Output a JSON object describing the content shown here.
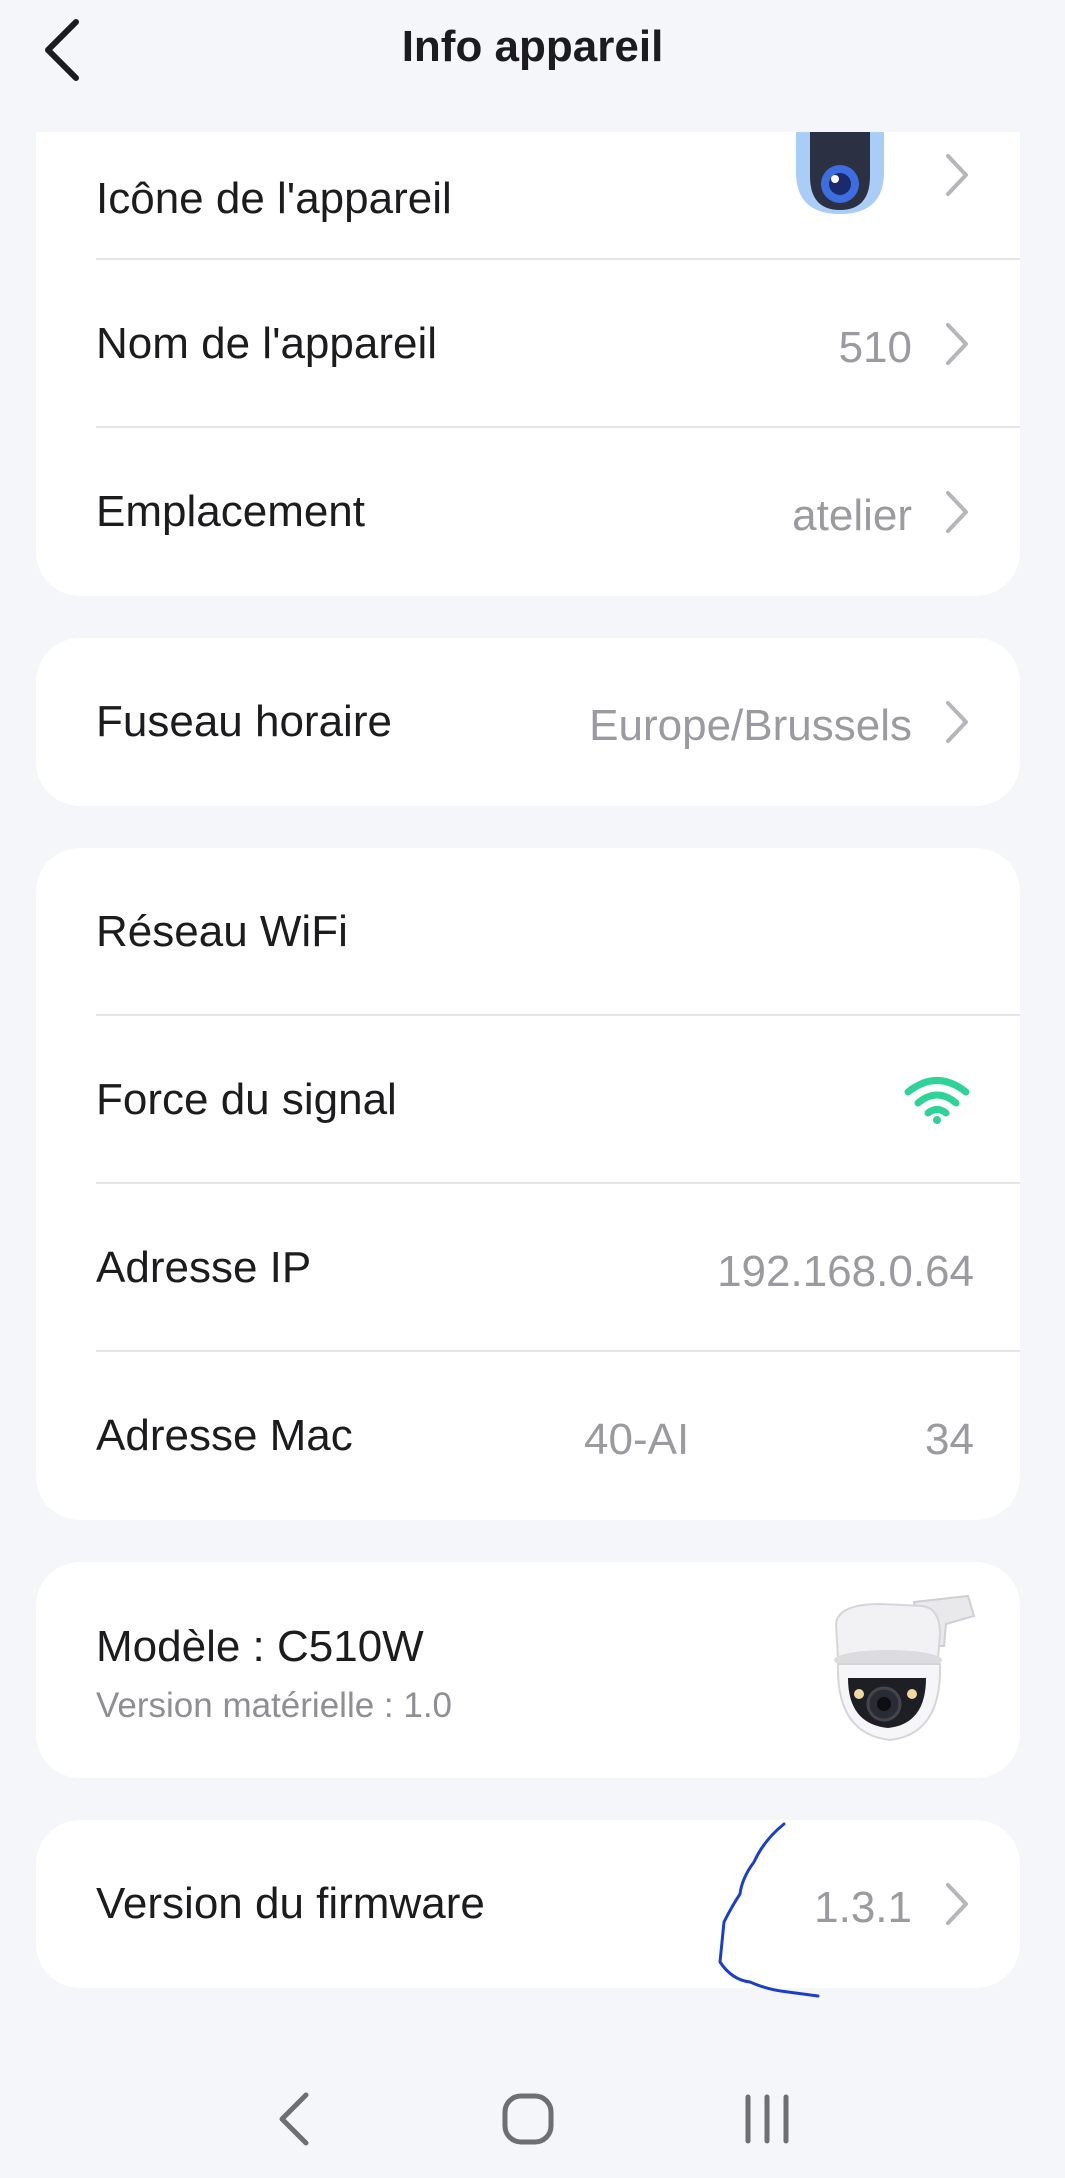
{
  "header": {
    "title": "Info appareil"
  },
  "device_card": {
    "icon_label": "Icône de l'appareil",
    "name_label": "Nom de l'appareil",
    "name_value": "510",
    "location_label": "Emplacement",
    "location_value": "atelier"
  },
  "timezone_card": {
    "label": "Fuseau horaire",
    "value": "Europe/Brussels"
  },
  "network_card": {
    "wifi_label": "Réseau WiFi",
    "signal_label": "Force du signal",
    "ip_label": "Adresse IP",
    "ip_value": "192.168.0.64",
    "mac_label": "Adresse Mac",
    "mac_value_start": "40-AI",
    "mac_value_end": "34"
  },
  "model_card": {
    "model": "Modèle : C510W",
    "hardware_version": "Version matérielle : 1.0"
  },
  "firmware_card": {
    "label": "Version du firmware",
    "value": "1.3.1"
  },
  "colors": {
    "background": "#f4f6fa",
    "card": "#ffffff",
    "value_gray": "#9a9a9f",
    "wifi_green": "#2ed39a",
    "annotation_blue": "#1a3fc9"
  },
  "icons": [
    "back-icon",
    "chevron-right-icon",
    "wifi-signal-icon",
    "camera-device-icon",
    "nav-back-icon",
    "nav-home-icon",
    "nav-recents-icon"
  ]
}
